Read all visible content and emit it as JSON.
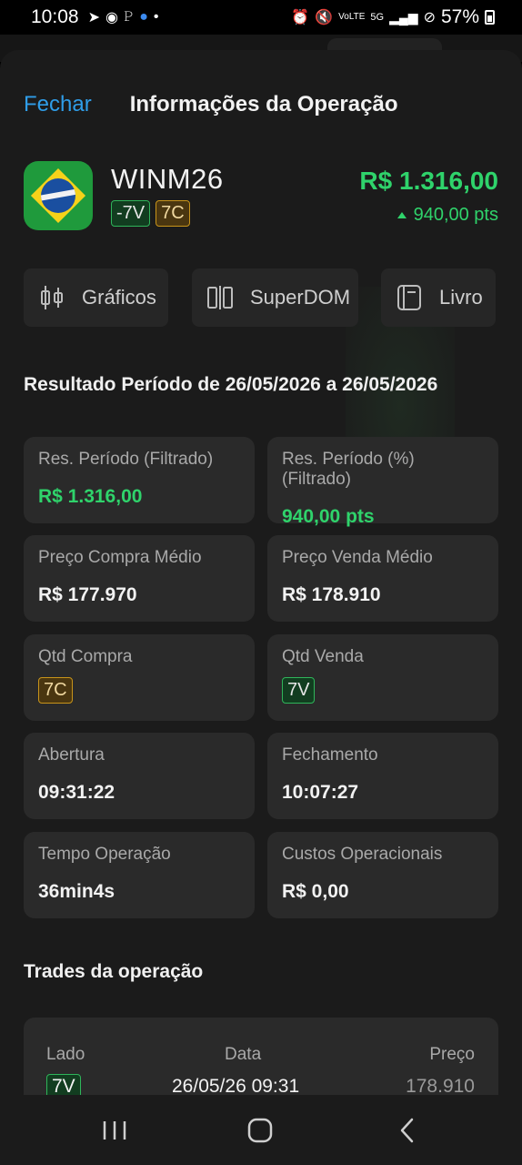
{
  "status_bar": {
    "time": "10:08",
    "battery": "57%",
    "left_icons": [
      "telegram-icon",
      "app-icon",
      "paypal-icon",
      "app-icon",
      "dot-icon"
    ],
    "right_icons": [
      "alarm-icon",
      "mute-icon",
      "volte-icon",
      "5g-icon",
      "signal-icon",
      "no-disturb-icon",
      "battery-icon"
    ]
  },
  "header": {
    "close_label": "Fechar",
    "title": "Informações da Operação"
  },
  "asset": {
    "symbol": "WINM26",
    "sell_badge": "-7V",
    "buy_badge": "7C",
    "value": "R$ 1.316,00",
    "points": "940,00 pts",
    "flag_icon": "brazil-flag-icon"
  },
  "actions": [
    {
      "label": "Gráficos",
      "icon": "candlestick-chart-icon"
    },
    {
      "label": "SuperDOM",
      "icon": "superdom-icon"
    },
    {
      "label": "Livro",
      "icon": "book-icon"
    }
  ],
  "period": {
    "title": "Resultado Período de 26/05/2026 a 26/05/2026"
  },
  "cards": {
    "res_periodo": {
      "label": "Res. Período (Filtrado)",
      "value": "R$ 1.316,00"
    },
    "res_periodo_pct": {
      "label": "Res. Período (%) (Filtrado)",
      "value": "940,00 pts"
    },
    "preco_compra": {
      "label": "Preço Compra Médio",
      "value": "R$ 177.970"
    },
    "preco_venda": {
      "label": "Preço Venda Médio",
      "value": "R$ 178.910"
    },
    "qtd_compra": {
      "label": "Qtd Compra",
      "value": "7C"
    },
    "qtd_venda": {
      "label": "Qtd Venda",
      "value": "7V"
    },
    "abertura": {
      "label": "Abertura",
      "value": "09:31:22"
    },
    "fechamento": {
      "label": "Fechamento",
      "value": "10:07:27"
    },
    "tempo": {
      "label": "Tempo Operação",
      "value": "36min4s"
    },
    "custos": {
      "label": "Custos Operacionais",
      "value": "R$ 0,00"
    }
  },
  "trades": {
    "title": "Trades da operação",
    "columns": [
      "Lado",
      "Data",
      "Preço"
    ],
    "rows": [
      {
        "lado": "7V",
        "data": "26/05/26 09:31",
        "preco": "178.910"
      }
    ]
  },
  "colors": {
    "accent_blue": "#2f9de8",
    "positive_green": "#2fd36b",
    "sell_badge": "#2fb55a",
    "buy_badge": "#c8941a",
    "background": "#1b1b1b",
    "card": "#2a2a2a"
  }
}
